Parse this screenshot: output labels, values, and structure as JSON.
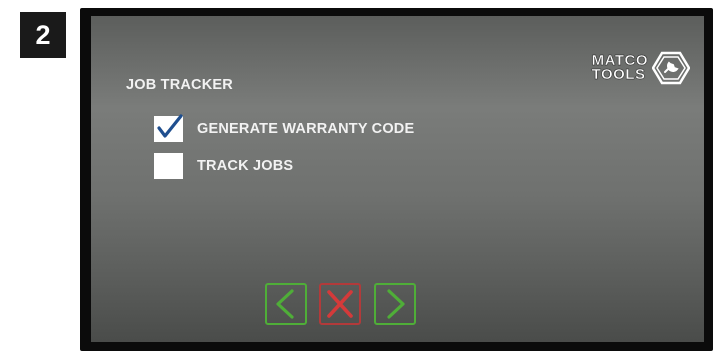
{
  "step_badge": "2",
  "logo": {
    "line1": "MATCO",
    "line2": "TOOLS"
  },
  "screen": {
    "title": "JOB TRACKER",
    "options": [
      {
        "label": "GENERATE WARRANTY CODE",
        "checked": true
      },
      {
        "label": "TRACK JOBS",
        "checked": false
      }
    ]
  },
  "buttons": {
    "back_icon": "chevron-left-icon",
    "cancel_icon": "x-icon",
    "next_icon": "chevron-right-icon"
  },
  "colors": {
    "nav_green": "#4fae38",
    "cancel_red": "#d43a3a",
    "checkmark_blue": "#1f4f8f"
  }
}
